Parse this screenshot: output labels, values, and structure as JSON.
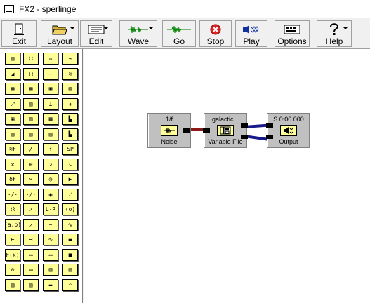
{
  "window": {
    "title": "FX2 - sperlinge",
    "icon": "app-wave-icon"
  },
  "toolbar": {
    "buttons": [
      {
        "label": "Exit",
        "icon": "exit-door-icon",
        "dropdown": false
      },
      {
        "label": "Layout",
        "icon": "folder-icon",
        "dropdown": true
      },
      {
        "label": "Edit",
        "icon": "document-icon",
        "dropdown": true
      },
      {
        "label": "Wave",
        "icon": "waveform-green-icon",
        "dropdown": true
      },
      {
        "label": "Go",
        "icon": "waveform-go-icon",
        "dropdown": false
      },
      {
        "label": "Stop",
        "icon": "stop-red-circle-icon",
        "dropdown": false
      },
      {
        "label": "Play",
        "icon": "speaker-icon",
        "dropdown": false
      },
      {
        "label": "Options",
        "icon": "options-panel-icon",
        "dropdown": false
      },
      {
        "label": "Help",
        "icon": "help-question-icon",
        "dropdown": true
      }
    ]
  },
  "palette": {
    "items": [
      "▥",
      "⌇⌇",
      "≈",
      "⌁",
      "◢",
      "⌇⌇",
      "—",
      "≋",
      "▦",
      "▦",
      "▣",
      "▤",
      "⤢",
      "▥",
      "⊥",
      "⇞",
      "▣",
      "▥",
      "▦",
      "▙",
      "▥",
      "▥",
      "▥",
      "▙",
      "≋F",
      "~/~",
      "⇡",
      "SP",
      "✕",
      "⊕",
      "↗",
      "↘",
      "δF",
      "✂",
      "◷",
      "▶",
      "·/·",
      "·/·",
      "◉",
      "⟋",
      "⌇⌇",
      "↗",
      "L-R",
      "(o)",
      "(a,b)",
      "↗",
      "~",
      "∿",
      "⊢",
      "⊣",
      "∿",
      "▬",
      "F(x)",
      "▭",
      "▭",
      "■",
      "⊙",
      "▭",
      "▥",
      "▥",
      "▥",
      "▥",
      "▬",
      "◠"
    ]
  },
  "modules": [
    {
      "id": "noise",
      "top": "1/f",
      "label": "Noise",
      "icon": "noise-waveform-icon"
    },
    {
      "id": "varfile",
      "top": "galactic...",
      "label": "Variable File",
      "icon": "disk-file-icon"
    },
    {
      "id": "output",
      "top": "S 0:00.000",
      "label": "Output",
      "icon": "speaker-output-icon"
    }
  ],
  "colors": {
    "module_bg": "#c0c0c0",
    "palette_bg": "#ffff99",
    "wire_mono": "#8b1a1a",
    "wire_stereo": "#1a1a8b"
  }
}
